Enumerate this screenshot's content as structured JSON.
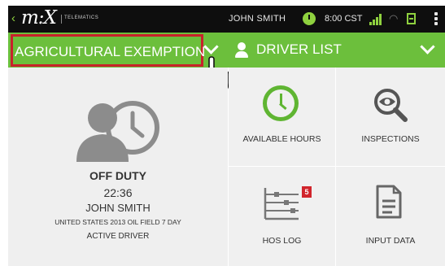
{
  "status_bar": {
    "back_glyph": "‹",
    "logo_text": "m:X",
    "logo_subtitle": "TELEMATICS",
    "user_name": "JOHN SMITH",
    "time": "8:00 CST",
    "icons": [
      "back-chevron-icon",
      "duty-clock-icon",
      "signal-icon",
      "wifi-icon",
      "vehicle-icon",
      "overflow-menu-icon"
    ]
  },
  "nav": {
    "exemption_label": "AGRICULTURAL EXEMPTION",
    "driver_list_label": "DRIVER LIST"
  },
  "driver": {
    "status": "OFF DUTY",
    "hours": "22:36",
    "name": "JOHN SMITH",
    "ruleset": "UNITED STATES 2013 OIL FIELD 7 DAY",
    "role": "ACTIVE DRIVER"
  },
  "tiles": [
    {
      "label": "AVAILABLE HOURS",
      "icon": "clock-icon"
    },
    {
      "label": "INSPECTIONS",
      "icon": "eye-magnifier-icon"
    },
    {
      "label": "HOS LOG",
      "icon": "log-graph-icon",
      "badge": "5"
    },
    {
      "label": "INPUT DATA",
      "icon": "document-icon"
    }
  ],
  "colors": {
    "accent_green": "#6cbf3c",
    "highlight_red": "#c8222b",
    "status_bar_bg": "#0e0e0e",
    "active_green": "#5fb532"
  }
}
